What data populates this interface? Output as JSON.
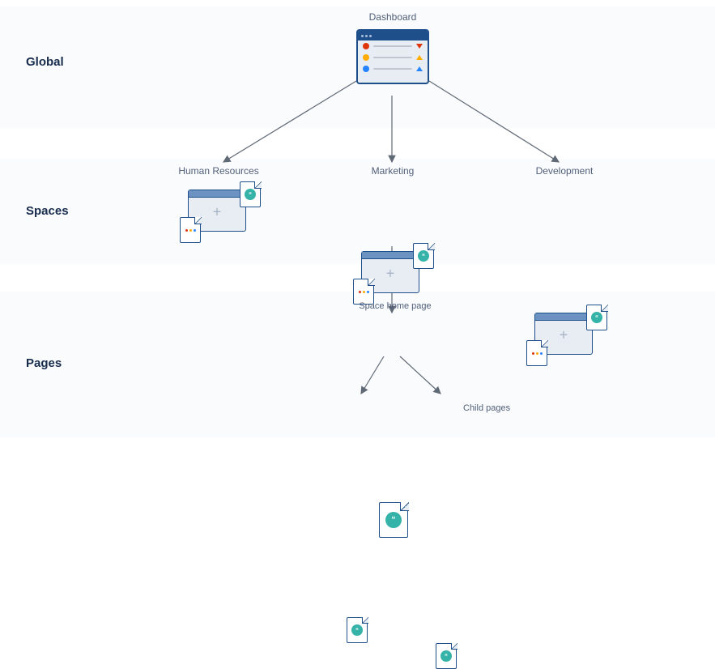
{
  "tiers": {
    "global": {
      "label": "Global"
    },
    "spaces": {
      "label": "Spaces"
    },
    "pages": {
      "label": "Pages"
    }
  },
  "dashboard": {
    "label": "Dashboard"
  },
  "spaces_list": [
    {
      "label": "Human Resources"
    },
    {
      "label": "Marketing"
    },
    {
      "label": "Development"
    }
  ],
  "page_hierarchy": {
    "home_label": "Space home page",
    "child_label": "Child pages"
  },
  "colors": {
    "frame": "#1e4f8b",
    "teal": "#36b3a8",
    "red": "#de350b",
    "yellow": "#ffab00",
    "blue": "#2684ff"
  }
}
